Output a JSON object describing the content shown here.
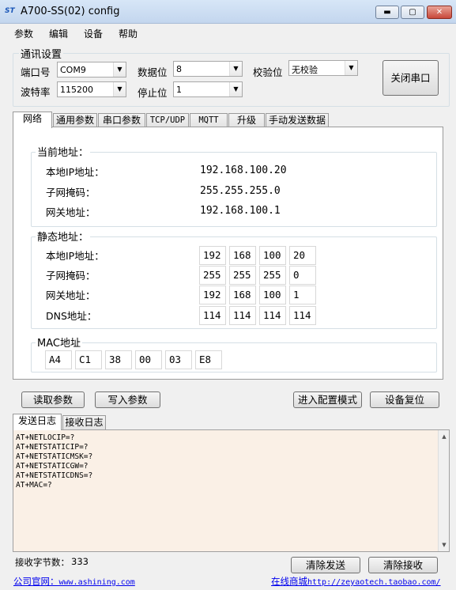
{
  "window": {
    "title": "A700-SS(02) config",
    "logo": "ST",
    "min": "▬",
    "max": "▢",
    "close": "✕"
  },
  "menu": [
    "参数",
    "编辑",
    "设备",
    "帮助"
  ],
  "comm": {
    "title": "通讯设置",
    "port_label": "端口号",
    "port_value": "COM9",
    "baud_label": "波特率",
    "baud_value": "115200",
    "databits_label": "数据位",
    "databits_value": "8",
    "stopbits_label": "停止位",
    "stopbits_value": "1",
    "parity_label": "校验位",
    "parity_value": "无校验",
    "close_port": "关闭串口"
  },
  "tabs": [
    "网络",
    "通用参数",
    "串口参数",
    "TCP/UDP",
    "MQTT",
    "升级",
    "手动发送数据"
  ],
  "current": {
    "title": "当前地址：",
    "ip_label": "本地IP地址：",
    "ip": "192.168.100.20",
    "mask_label": "子网掩码：",
    "mask": "255.255.255.0",
    "gw_label": "网关地址：",
    "gw": "192.168.100.1"
  },
  "static": {
    "title": "静态地址：",
    "ip_label": "本地IP地址：",
    "ip": [
      "192",
      "168",
      "100",
      "20"
    ],
    "mask_label": "子网掩码：",
    "mask": [
      "255",
      "255",
      "255",
      "0"
    ],
    "gw_label": "网关地址：",
    "gw": [
      "192",
      "168",
      "100",
      "1"
    ],
    "dns_label": "DNS地址：",
    "dns": [
      "114",
      "114",
      "114",
      "114"
    ]
  },
  "mac": {
    "title": "MAC地址",
    "bytes": [
      "A4",
      "C1",
      "38",
      "00",
      "03",
      "E8"
    ]
  },
  "buttons": {
    "read": "读取参数",
    "write": "写入参数",
    "config_mode": "进入配置模式",
    "reset": "设备复位"
  },
  "log_tabs": [
    "发送日志",
    "接收日志"
  ],
  "log_lines": [
    "AT+NETLOCIP=?",
    "AT+NETSTATICIP=?",
    "AT+NETSTATICMSK=?",
    "AT+NETSTATICGW=?",
    "AT+NETSTATICDNS=?",
    "AT+MAC=?"
  ],
  "footer": {
    "recv_label": "接收字节数：",
    "recv_count": "333",
    "clear_send": "清除发送",
    "clear_recv": "清除接收",
    "site_label": "公司官网：",
    "site_url": "www.ashining.com",
    "shop_label": "在线商城",
    "shop_url": "http://zeyaotech.taobao.com/"
  }
}
